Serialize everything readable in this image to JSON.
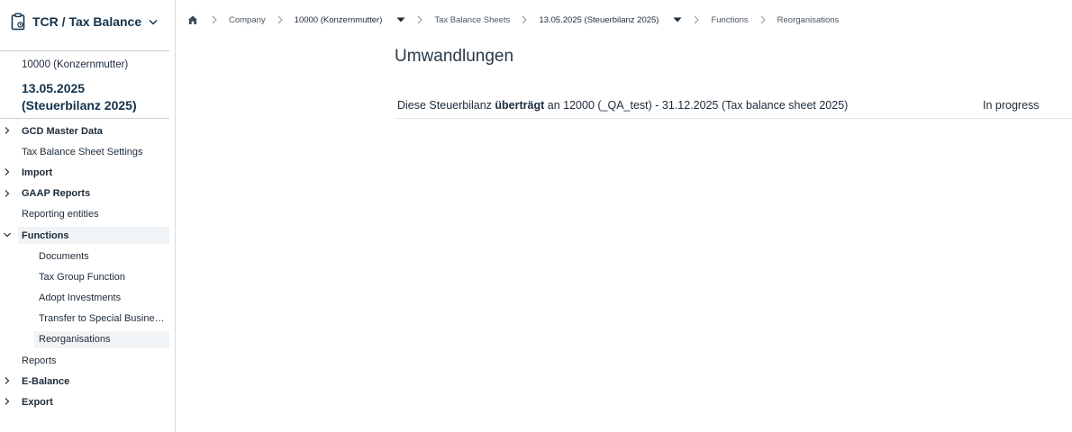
{
  "app": {
    "title": "TCR / Tax Balance"
  },
  "context": {
    "company": "10000 (Konzernmutter)",
    "sheet": "13.05.2025 (Steuerbilanz 2025)"
  },
  "nav": {
    "items": [
      {
        "label": "GCD Master Data"
      },
      {
        "label": "Tax Balance Sheet Settings"
      },
      {
        "label": "Import"
      },
      {
        "label": "GAAP Reports"
      },
      {
        "label": "Reporting entities"
      },
      {
        "label": "Functions"
      },
      {
        "label": "Documents"
      },
      {
        "label": "Tax Group Function"
      },
      {
        "label": "Adopt Investments"
      },
      {
        "label": "Transfer to Special Business Assets"
      },
      {
        "label": "Reorganisations"
      },
      {
        "label": "Reports"
      },
      {
        "label": "E-Balance"
      },
      {
        "label": "Export"
      }
    ]
  },
  "breadcrumb": {
    "company": "Company",
    "entity": "10000 (Konzernmutter)",
    "sheets": "Tax Balance Sheets",
    "sheet": "13.05.2025 (Steuerbilanz 2025)",
    "functions": "Functions",
    "current": "Reorganisations"
  },
  "main": {
    "title": "Umwandlungen",
    "rows": [
      {
        "prefix": "Diese Steuerbilanz",
        "verb": "überträgt",
        "suffix": "an 12000 (_QA_test) - 31.12.2025 (Tax balance sheet 2025)",
        "status": "In progress"
      }
    ]
  },
  "colors": {
    "brand": "#13324b",
    "highlight": "#f1f4f6",
    "divider": "#d9dde1"
  }
}
